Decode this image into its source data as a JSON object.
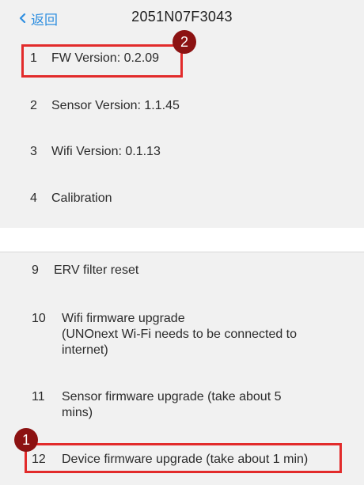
{
  "header": {
    "back_label": "返回",
    "title": "2051N07F3043"
  },
  "top_items": [
    {
      "num": "1",
      "label": "FW Version: 0.2.09"
    },
    {
      "num": "2",
      "label": "Sensor Version: 1.1.45"
    },
    {
      "num": "3",
      "label": "Wifi Version: 0.1.13"
    },
    {
      "num": "4",
      "label": "Calibration"
    }
  ],
  "bottom_items": [
    {
      "num": "9",
      "label": "ERV filter reset"
    },
    {
      "num": "10",
      "label": "Wifi firmware upgrade\n(UNOnext Wi-Fi needs to be connected to\ninternet)"
    },
    {
      "num": "11",
      "label": "Sensor firmware upgrade (take about 5\nmins)"
    },
    {
      "num": "12",
      "label": "Device firmware upgrade (take about 1 min)"
    }
  ],
  "annotations": [
    {
      "label": "2",
      "color": "#e22b2b"
    },
    {
      "label": "1",
      "color": "#e22b2b"
    }
  ],
  "icons": {
    "back": "chevron-left-icon"
  }
}
